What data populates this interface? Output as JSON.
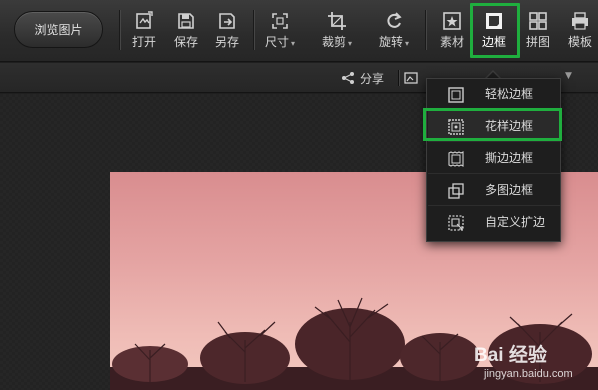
{
  "toolbar": {
    "browse_label": "浏览图片",
    "tools": [
      {
        "label": "打开",
        "icon": "open-icon",
        "has_dropdown": false
      },
      {
        "label": "保存",
        "icon": "save-icon",
        "has_dropdown": false
      },
      {
        "label": "另存",
        "icon": "save-as-icon",
        "has_dropdown": false
      },
      {
        "label": "尺寸",
        "icon": "resize-icon",
        "has_dropdown": true
      },
      {
        "label": "裁剪",
        "icon": "crop-icon",
        "has_dropdown": true
      },
      {
        "label": "旋转",
        "icon": "rotate-icon",
        "has_dropdown": true
      },
      {
        "label": "素材",
        "icon": "material-icon",
        "has_dropdown": false
      },
      {
        "label": "边框",
        "icon": "frame-icon",
        "has_dropdown": false,
        "active": true
      },
      {
        "label": "拼图",
        "icon": "collage-icon",
        "has_dropdown": false
      },
      {
        "label": "模板",
        "icon": "template-icon",
        "has_dropdown": false
      }
    ]
  },
  "subbar": {
    "share_label": "分享"
  },
  "frame_menu": {
    "items": [
      {
        "label": "轻松边框",
        "icon": "simple-frame-icon"
      },
      {
        "label": "花样边框",
        "icon": "pattern-frame-icon",
        "selected": true
      },
      {
        "label": "撕边边框",
        "icon": "torn-edge-frame-icon"
      },
      {
        "label": "多图边框",
        "icon": "multi-image-frame-icon"
      },
      {
        "label": "自定义扩边",
        "icon": "custom-expand-icon"
      }
    ]
  },
  "watermark": {
    "main": "Bai 经验",
    "sub": "jingyan.baidu.com"
  },
  "colors": {
    "highlight": "#1fae3e",
    "toolbar_bg": "#2e2e2e",
    "photo_sky_top": "#d98d8f",
    "photo_sky_bottom": "#f3c9c0"
  }
}
